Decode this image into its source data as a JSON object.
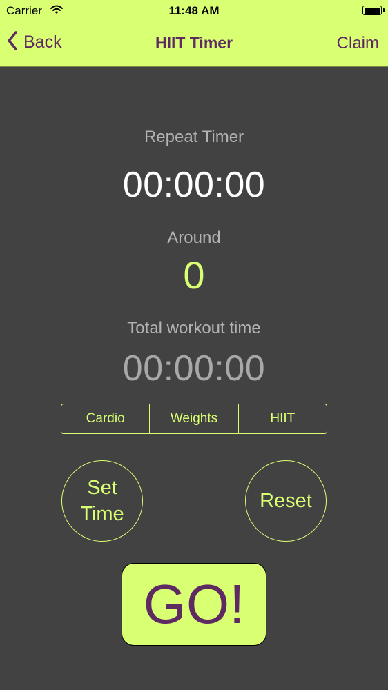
{
  "status_bar": {
    "carrier": "Carrier",
    "time": "11:48 AM"
  },
  "nav": {
    "back_label": "Back",
    "title": "HIIT Timer",
    "right_label": "Claim"
  },
  "timer": {
    "repeat_label": "Repeat Timer",
    "repeat_value": "00:00:00",
    "round_label": "Around",
    "round_value": "0",
    "total_label": "Total workout time",
    "total_value": "00:00:00"
  },
  "segments": [
    "Cardio",
    "Weights",
    "HIIT"
  ],
  "buttons": {
    "set_time_line1": "Set",
    "set_time_line2": "Time",
    "reset": "Reset",
    "go": "GO!"
  },
  "colors": {
    "accent": "#d9ff73",
    "purple": "#5e2a62",
    "background": "#424242"
  }
}
